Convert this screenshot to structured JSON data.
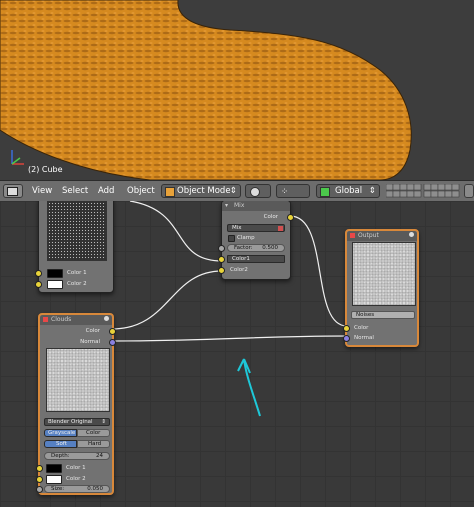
{
  "viewport": {
    "object_label": "(2) Cube",
    "mesh_color": "#d88a1e"
  },
  "toolbar": {
    "menus": [
      "View",
      "Select",
      "Add",
      "Object"
    ],
    "mode": "Object Mode",
    "orientation": "Global"
  },
  "nodes": {
    "mix": {
      "title": "Mix",
      "output_color": "Color",
      "blend": "Mix",
      "clamp_label": "Clamp",
      "factor_label": "Factor:",
      "factor_value": "0.500",
      "input1": "Color1",
      "input2": "Color2"
    },
    "top_texture": {
      "color1": "Color 1",
      "color2": "Color 2"
    },
    "clouds": {
      "title": "Clouds",
      "output_color": "Color",
      "output_normal": "Normal",
      "basis": "Blender Original",
      "grayscale": "Grayscale",
      "color": "Color",
      "soft": "Soft",
      "hard": "Hard",
      "depth_label": "Depth:",
      "depth_value": "24",
      "color1": "Color 1",
      "color2": "Color 2",
      "size_label": "Size:",
      "size_value": "0.050"
    },
    "output": {
      "title": "Output",
      "name_field": "Noises",
      "input_color": "Color",
      "input_normal": "Normal"
    }
  },
  "colors": {
    "node_selected_border": "#d8883a",
    "socket_color": "#e8d33a",
    "socket_vector": "#8a80e0",
    "annotation_arrow": "#1ec8d8"
  }
}
